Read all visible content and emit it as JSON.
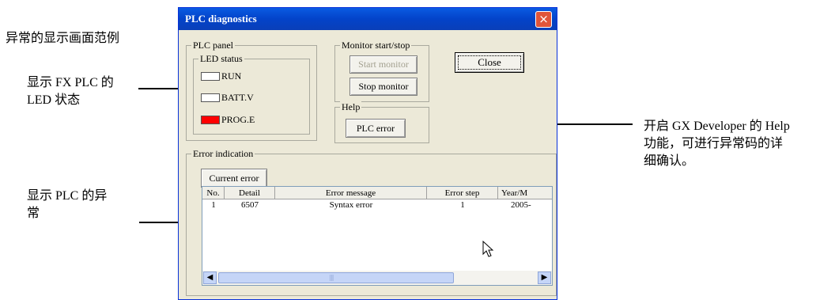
{
  "annotations": {
    "title_note": "异常的显示画面范例",
    "led_note_line1": "显示 FX PLC 的",
    "led_note_line2": "LED 状态",
    "error_note_line1": "显示 PLC 的异",
    "error_note_line2": "常",
    "help_note_line1": "开启 GX Developer 的 Help",
    "help_note_line2": "功能，可进行异常码的详",
    "help_note_line3": "细确认。"
  },
  "window": {
    "title": "PLC diagnostics",
    "close_glyph": "×"
  },
  "plc_panel": {
    "label": "PLC panel",
    "led_status_label": "LED status",
    "leds": [
      {
        "label": "RUN",
        "color": "#ffffff"
      },
      {
        "label": "BATT.V",
        "color": "#ffffff"
      },
      {
        "label": "PROG.E",
        "color": "#ff0000"
      }
    ]
  },
  "monitor": {
    "label": "Monitor start/stop",
    "start_label": "Start monitor",
    "stop_label": "Stop monitor"
  },
  "close_button_label": "Close",
  "help": {
    "label": "Help",
    "plc_error_label": "PLC error"
  },
  "error_indication": {
    "label": "Error indication",
    "current_error_label": "Current error",
    "columns": [
      "No.",
      "Detail",
      "Error message",
      "Error step",
      "Year/M"
    ],
    "rows": [
      {
        "no": "1",
        "detail": "6507",
        "message": "Syntax error",
        "step": "1",
        "year": "2005-"
      }
    ]
  },
  "scrollbar": {
    "left_glyph": "◀",
    "right_glyph": "▶",
    "grip_glyph": "|||"
  },
  "cursor_icon": "arrow-cursor-icon"
}
